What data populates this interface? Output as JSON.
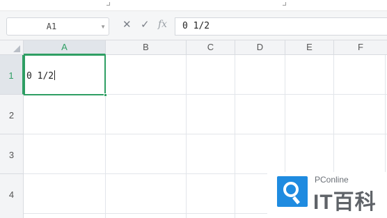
{
  "formula_bar": {
    "name_box": "A1",
    "cancel_glyph": "✕",
    "confirm_glyph": "✓",
    "fx_label": "fx",
    "formula_value": "0 1/2"
  },
  "grid": {
    "columns": [
      "A",
      "B",
      "C",
      "D",
      "E",
      "F"
    ],
    "rows": [
      "1",
      "2",
      "3",
      "4"
    ],
    "selected_column": "A",
    "selected_row": "1",
    "active_cell_value": "0 1/2"
  },
  "watermark": {
    "brand": "PConline",
    "logo_text": "IT百科"
  },
  "colors": {
    "selection": "#2e9e63",
    "header_bg": "#f3f4f6",
    "watermark_blue": "#1f8be0"
  },
  "icons": [
    "dropdown-arrow-icon",
    "cancel-icon",
    "confirm-icon",
    "fx-icon",
    "select-all-icon",
    "search-logo-icon"
  ]
}
